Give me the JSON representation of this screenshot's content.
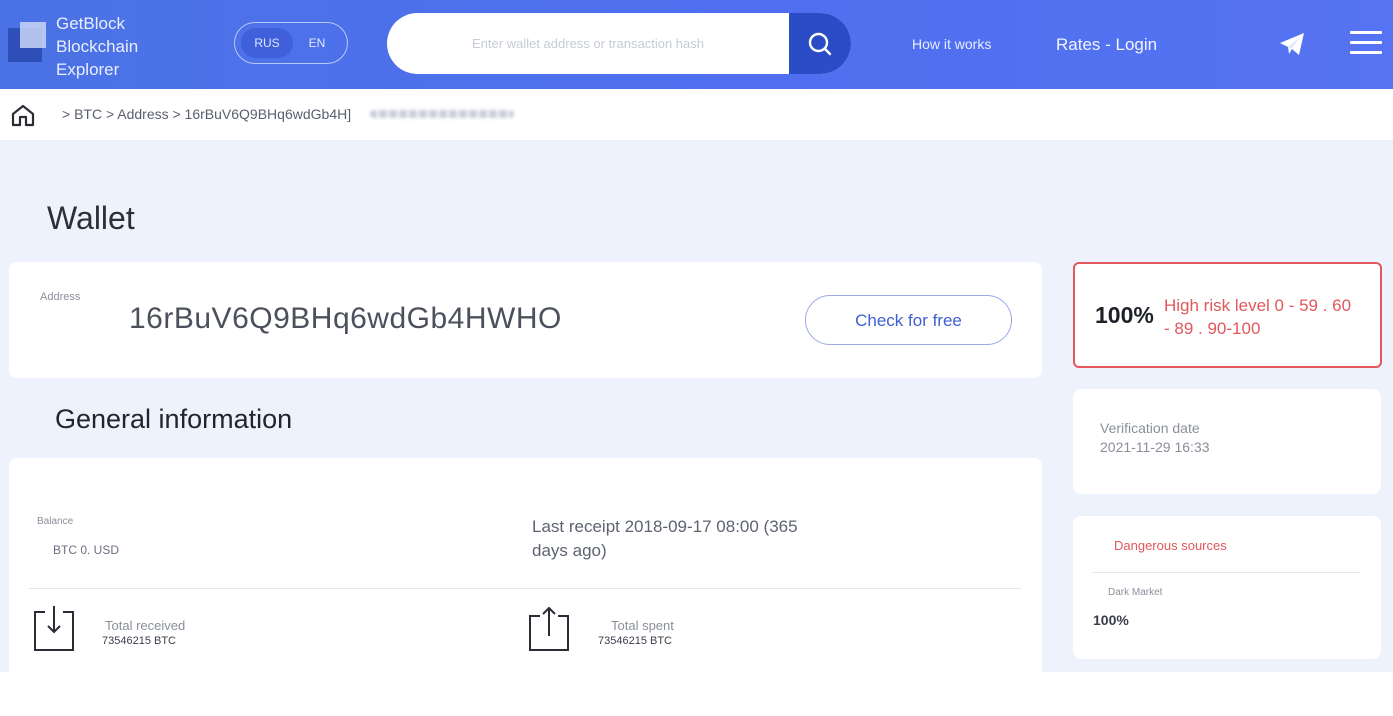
{
  "header": {
    "logo_lines": [
      "GetBlock",
      "Blockchain",
      "Explorer"
    ],
    "lang": {
      "rus": "RUS",
      "en": "EN",
      "active": "RUS"
    },
    "search": {
      "placeholder": "Enter wallet address or transaction hash",
      "value": ""
    },
    "nav": {
      "how_it_works": "How it works",
      "rates_login": "Rates - Login"
    },
    "icons": {
      "search": "search-icon",
      "telegram": "telegram-icon",
      "menu": "menu-icon"
    },
    "colors": {
      "header_bg": "#4f6ff0",
      "search_btn": "#2b4cc7"
    }
  },
  "breadcrumb": {
    "text": "> BTC > Address > 16rBuV6Q9BHq6wdGb4H]",
    "home_icon": "home-icon"
  },
  "wallet": {
    "title": "Wallet",
    "address_label": "Address",
    "address_value": "16rBuV6Q9BHq6wdGb4HWHO",
    "check_button": "Check for free"
  },
  "general": {
    "title": "General information",
    "balance_label": "Balance",
    "balance_value": "BTC 0. USD",
    "last_receipt": "Last receipt 2018-09-17 08:00 (365 days ago)",
    "total_received_label": "Total received",
    "total_received_value": "73546215 BTC",
    "total_spent_label": "Total spent",
    "total_spent_value": "73546215 BTC"
  },
  "risk": {
    "percent": "100%",
    "text": "High risk level 0 - 59 . 60 - 89 . 90-100",
    "color": "#e0585c"
  },
  "verification": {
    "label": "Verification date",
    "value": "2021-11-29 16:33"
  },
  "danger": {
    "title": "Dangerous sources",
    "source_label": "Dark Market",
    "source_value": "100%"
  }
}
